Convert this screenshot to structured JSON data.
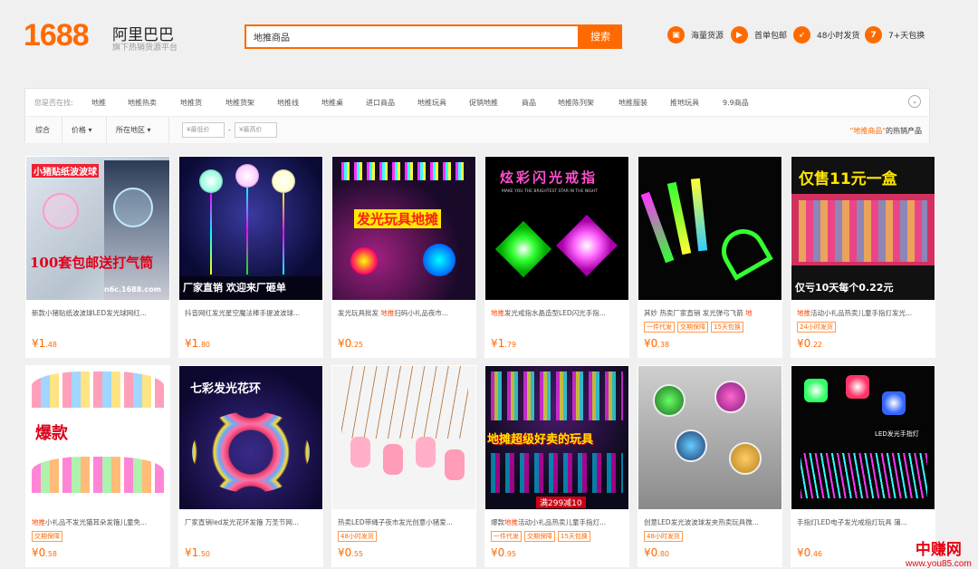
{
  "header": {
    "logo_num": "1688",
    "logo_cn": "阿里巴巴",
    "logo_sub": "旗下热销货源平台",
    "search_value": "地推商品",
    "search_button": "搜索",
    "features": [
      {
        "icon": "box-icon",
        "label": "海量货源"
      },
      {
        "icon": "truck-icon",
        "label": "首单包邮"
      },
      {
        "icon": "rocket-icon",
        "label": "48小时发货"
      },
      {
        "icon": "seven-icon",
        "label": "7+天包换"
      }
    ]
  },
  "filters": {
    "prefix": "您是否在找:",
    "keywords": [
      "地推",
      "地推热卖",
      "地推货",
      "地推货架",
      "地推线",
      "地推桌",
      "进口商品",
      "地推玩具",
      "促销地推",
      "商品",
      "地推陈列架",
      "地推服装",
      "推地玩具",
      "9.9商品"
    ],
    "sort_all": "综合",
    "sort_price": "价格",
    "sort_region": "所在地区",
    "price_min_placeholder": "¥最低价",
    "price_dash": "-",
    "price_max_placeholder": "¥最高价",
    "hot_kw": "\"地推商品\"",
    "hot_suffix": "的热销产品"
  },
  "products": [
    {
      "title_pre": "新款小猪贴纸波波球LED发光球网红...",
      "title_hl": "",
      "title_post": "",
      "tags": [],
      "price_int": "1",
      "price_dec": ".48",
      "img_text": "100套包邮送打气筒",
      "img_text2": "小猪贴纸波波球",
      "img_text3": "n6c.1688.com"
    },
    {
      "title_pre": "抖音网红发光星空魔法棒手提波波球...",
      "title_hl": "",
      "title_post": "",
      "tags": [],
      "price_int": "1",
      "price_dec": ".80",
      "img_text": "厂家直销  欢迎来厂砸单"
    },
    {
      "title_pre": "发光玩具批发 ",
      "title_hl": "地推",
      "title_post": "扫码小礼品夜市...",
      "tags": [],
      "price_int": "0",
      "price_dec": ".25",
      "img_text": "发光玩具地摊"
    },
    {
      "title_pre": "",
      "title_hl": "地推",
      "title_post": "发光戒指水晶造型LED闪光手指...",
      "tags": [],
      "price_int": "1",
      "price_dec": ".79",
      "img_text": "炫彩闪光戒指",
      "img_text2": "MAKE YOU THE BRIGHTEST STAR IN THE NIGHT"
    },
    {
      "title_pre": "其妙 热卖厂家直销 发光弹弓飞箭 ",
      "title_hl": "地",
      "title_post": "",
      "tags": [
        "一件代发",
        "交期保障",
        "15天包换"
      ],
      "price_int": "0",
      "price_dec": ".38"
    },
    {
      "title_pre": "",
      "title_hl": "地推",
      "title_post": "活动小礼品热卖儿童手指灯发光...",
      "tags": [
        "24小时发货"
      ],
      "price_int": "0",
      "price_dec": ".22",
      "img_text": "仅售11元一盒",
      "img_text2": "仅亏10天每个0.22元"
    },
    {
      "title_pre": "",
      "title_hl": "地推",
      "title_post": "小礼品不发光猫耳朵发箍儿童免...",
      "tags": [
        "交期保障"
      ],
      "price_int": "0",
      "price_dec": ".58",
      "img_text": "爆款"
    },
    {
      "title_pre": "厂家直销led发光花环发箍 万圣节网...",
      "title_hl": "",
      "title_post": "",
      "tags": [],
      "price_int": "1",
      "price_dec": ".50",
      "img_text": "七彩发光花环"
    },
    {
      "title_pre": "热卖LED带绳子夜市发光创意小猪爱...",
      "title_hl": "",
      "title_post": "",
      "tags": [
        "48小时发货"
      ],
      "price_int": "0",
      "price_dec": ".55"
    },
    {
      "title_pre": "爆款",
      "title_hl": "地推",
      "title_post": "活动小礼品热卖儿童手指灯...",
      "tags": [
        "一件代发",
        "交期保障",
        "15天包换"
      ],
      "price_int": "0",
      "price_dec": ".95",
      "img_text": "地摊超级好卖的玩具",
      "img_text2": "满299减10"
    },
    {
      "title_pre": "创意LED发光波波球发夹热卖玩具微...",
      "title_hl": "",
      "title_post": "",
      "tags": [
        "48小时发货"
      ],
      "price_int": "0",
      "price_dec": ".80"
    },
    {
      "title_pre": "手指灯LED电子发光戒指灯玩具 蒲...",
      "title_hl": "",
      "title_post": "",
      "tags": [],
      "price_int": "0",
      "price_dec": ".46",
      "img_text": "LED发光手指灯"
    }
  ],
  "currency": "¥",
  "watermark": {
    "cn": "中赚网",
    "url": "www.you85.com"
  }
}
